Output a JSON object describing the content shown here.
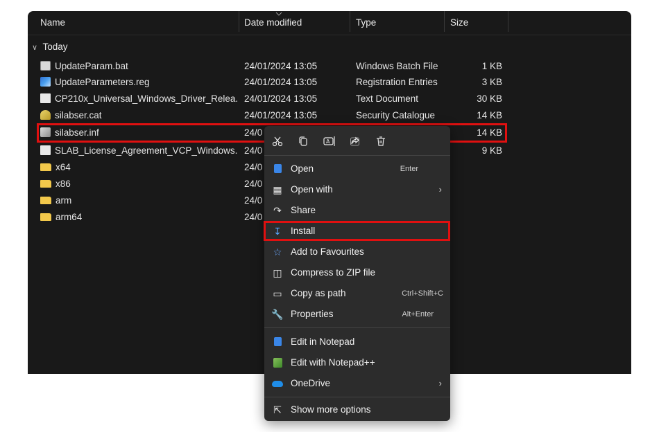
{
  "explorer": {
    "columns": {
      "name": "Name",
      "date": "Date modified",
      "type": "Type",
      "size": "Size"
    },
    "group_label": "Today",
    "files": [
      {
        "name": "UpdateParam.bat",
        "date": "24/01/2024 13:05",
        "type": "Windows Batch File",
        "size": "1 KB",
        "icon": "batch-file-icon"
      },
      {
        "name": "UpdateParameters.reg",
        "date": "24/01/2024 13:05",
        "type": "Registration Entries",
        "size": "3 KB",
        "icon": "registry-file-icon"
      },
      {
        "name": "CP210x_Universal_Windows_Driver_Relea...",
        "date": "24/01/2024 13:05",
        "type": "Text Document",
        "size": "30 KB",
        "icon": "text-file-icon"
      },
      {
        "name": "silabser.cat",
        "date": "24/01/2024 13:05",
        "type": "Security Catalogue",
        "size": "14 KB",
        "icon": "catalog-file-icon"
      },
      {
        "name": "silabser.inf",
        "date": "24/0",
        "type": "",
        "size": "14 KB",
        "icon": "setup-info-file-icon"
      },
      {
        "name": "SLAB_License_Agreement_VCP_Windows....",
        "date": "24/0",
        "type": "",
        "size": "9 KB",
        "icon": "text-file-icon"
      },
      {
        "name": "x64",
        "date": "24/0",
        "type": "",
        "size": "",
        "icon": "folder-icon"
      },
      {
        "name": "x86",
        "date": "24/0",
        "type": "",
        "size": "",
        "icon": "folder-icon"
      },
      {
        "name": "arm",
        "date": "24/0",
        "type": "",
        "size": "",
        "icon": "folder-icon"
      },
      {
        "name": "arm64",
        "date": "24/0",
        "type": "",
        "size": "",
        "icon": "folder-icon"
      }
    ]
  },
  "context_menu": {
    "toolbar_icons": [
      "cut-icon",
      "copy-icon",
      "rename-icon",
      "share-icon",
      "delete-icon"
    ],
    "items": [
      {
        "label": "Open",
        "shortcut": "Enter",
        "icon": "open-icon"
      },
      {
        "label": "Open with",
        "shortcut": "",
        "icon": "open-with-icon",
        "submenu": true
      },
      {
        "label": "Share",
        "shortcut": "",
        "icon": "share-icon"
      },
      {
        "label": "Install",
        "shortcut": "",
        "icon": "install-icon"
      },
      {
        "label": "Add to Favourites",
        "shortcut": "",
        "icon": "star-icon"
      },
      {
        "label": "Compress to ZIP file",
        "shortcut": "",
        "icon": "zip-icon"
      },
      {
        "label": "Copy as path",
        "shortcut": "Ctrl+Shift+C",
        "icon": "copy-path-icon"
      },
      {
        "label": "Properties",
        "shortcut": "Alt+Enter",
        "icon": "wrench-icon"
      },
      {
        "label": "Edit in Notepad",
        "shortcut": "",
        "icon": "notepad-icon"
      },
      {
        "label": "Edit with Notepad++",
        "shortcut": "",
        "icon": "notepad-plus-plus-icon"
      },
      {
        "label": "OneDrive",
        "shortcut": "",
        "icon": "onedrive-cloud-icon",
        "submenu": true
      },
      {
        "label": "Show more options",
        "shortcut": "",
        "icon": "show-more-icon"
      }
    ]
  },
  "colors": {
    "explorer_bg": "#191919",
    "menu_bg": "#2c2c2c",
    "highlight_border": "#e01010",
    "folder": "#f2c84b"
  }
}
